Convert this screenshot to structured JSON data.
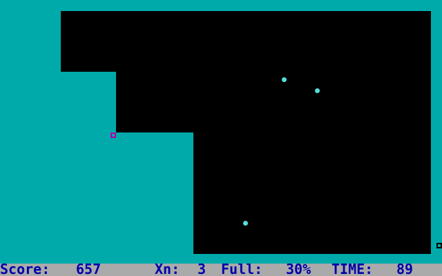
{
  "game": {
    "colors": {
      "filled": "#00AAAA",
      "unfilled": "#000000",
      "ball": "#55DDDD",
      "player": "#AA00AA",
      "status_bar_bg": "#AAAAAA",
      "status_text": "#0000AA"
    },
    "status": {
      "score_label": "Score:",
      "score_value": "657",
      "xn_label": "Xn:",
      "xn_value": "3",
      "full_label": "Full:",
      "full_value": "30%",
      "time_label": "TIME:",
      "time_value": "89"
    }
  }
}
